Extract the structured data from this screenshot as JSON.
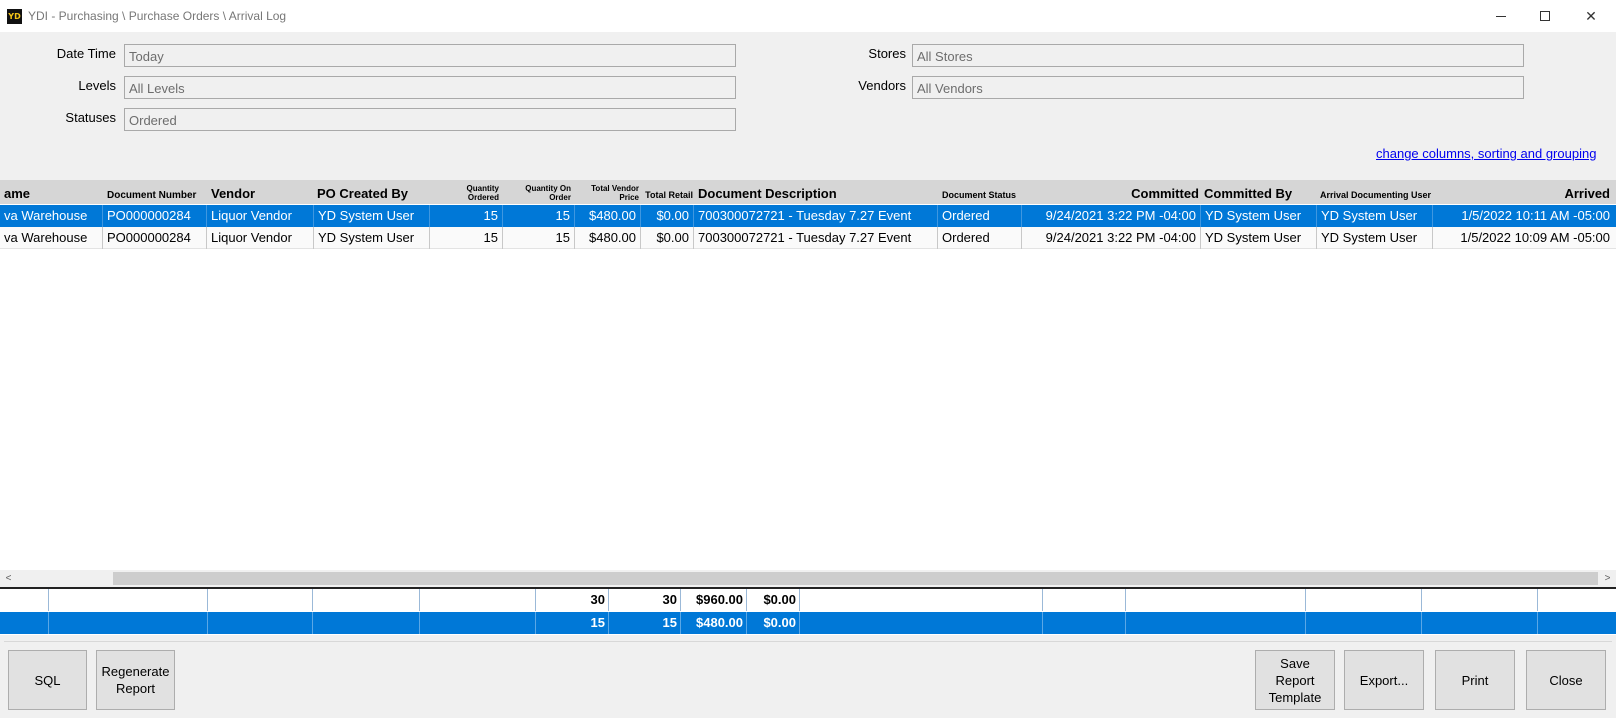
{
  "window": {
    "logo_text": "YD",
    "title": "YDI - Purchasing \\ Purchase Orders \\ Arrival Log",
    "minimize": "minimize",
    "maximize": "maximize",
    "close": "✕"
  },
  "filters": {
    "date_time": {
      "label": "Date Time",
      "value": "Today"
    },
    "levels": {
      "label": "Levels",
      "value": "All Levels"
    },
    "statuses": {
      "label": "Statuses",
      "value": "Ordered"
    },
    "stores": {
      "label": "Stores",
      "value": "All Stores"
    },
    "vendors": {
      "label": "Vendors",
      "value": "All Vendors"
    }
  },
  "change_columns_link": "change columns, sorting and grouping",
  "grid": {
    "columns": [
      "ame",
      "Document Number",
      "Vendor",
      "PO Created By",
      "Quantity Ordered",
      "Quantity On Order",
      "Total Vendor Price",
      "Total Retail",
      "Document Description",
      "Document Status",
      "Committed",
      "Committed By",
      "Arrival Documenting User",
      "Arrived"
    ],
    "rows": [
      [
        "va Warehouse",
        "PO000000284",
        "Liquor Vendor",
        "YD System User",
        "15",
        "15",
        "$480.00",
        "$0.00",
        "700300072721 - Tuesday 7.27 Event",
        "Ordered",
        "9/24/2021 3:22 PM -04:00",
        "YD System User",
        "YD System User",
        "1/5/2022 10:11 AM -05:00"
      ],
      [
        "va Warehouse",
        "PO000000284",
        "Liquor Vendor",
        "YD System User",
        "15",
        "15",
        "$480.00",
        "$0.00",
        "700300072721 - Tuesday 7.27 Event",
        "Ordered",
        "9/24/2021 3:22 PM -04:00",
        "YD System User",
        "YD System User",
        "1/5/2022 10:09 AM -05:00"
      ]
    ]
  },
  "summary": {
    "totals": [
      "30",
      "30",
      "$960.00",
      "$0.00"
    ],
    "selected": [
      "15",
      "15",
      "$480.00",
      "$0.00"
    ]
  },
  "scrollbar": {
    "left_arrow": "<",
    "right_arrow": ">"
  },
  "buttons": {
    "sql": "SQL",
    "regenerate_line1": "Regenerate",
    "regenerate_line2": "Report",
    "save_line1": "Save",
    "save_line2": "Report",
    "save_line3": "Template",
    "export": "Export...",
    "print": "Print",
    "close": "Close"
  }
}
